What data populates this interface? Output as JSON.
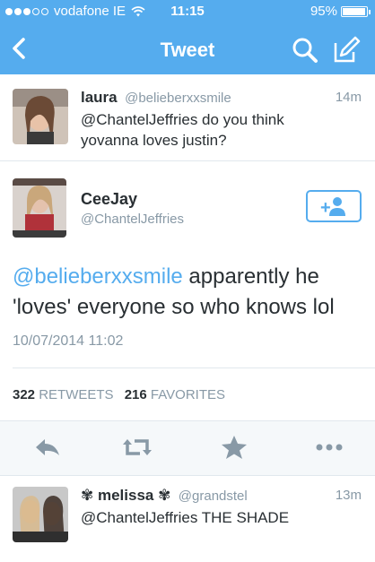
{
  "status_bar": {
    "carrier": "vodafone IE",
    "time": "11:15",
    "battery": "95%",
    "battery_level": 0.95
  },
  "nav": {
    "title": "Tweet"
  },
  "reply_tweet": {
    "name": "laura",
    "handle": "@belieberxxsmile",
    "time": "14m",
    "text_line1": "@ChantelJeffries do you think",
    "text_line2": "yovanna loves justin?"
  },
  "main_tweet": {
    "name": "CeeJay",
    "handle": "@ChantelJeffries",
    "mention": "@belieberxxsmile",
    "text_line1_rest": " apparently he",
    "text_line2": "'loves' everyone so who knows lol",
    "timestamp": "10/07/2014 11:02",
    "retweets_count": "322",
    "retweets_label": "RETWEETS",
    "favorites_count": "216",
    "favorites_label": "FAVORITES",
    "follow_label": "+"
  },
  "next_tweet": {
    "name": "✾ melissa ✾",
    "handle": "@grandstel",
    "time": "13m",
    "text": "@ChantelJeffries THE SHADE"
  },
  "colors": {
    "accent": "#55acee",
    "text": "#292f33",
    "muted": "#8899a6"
  }
}
